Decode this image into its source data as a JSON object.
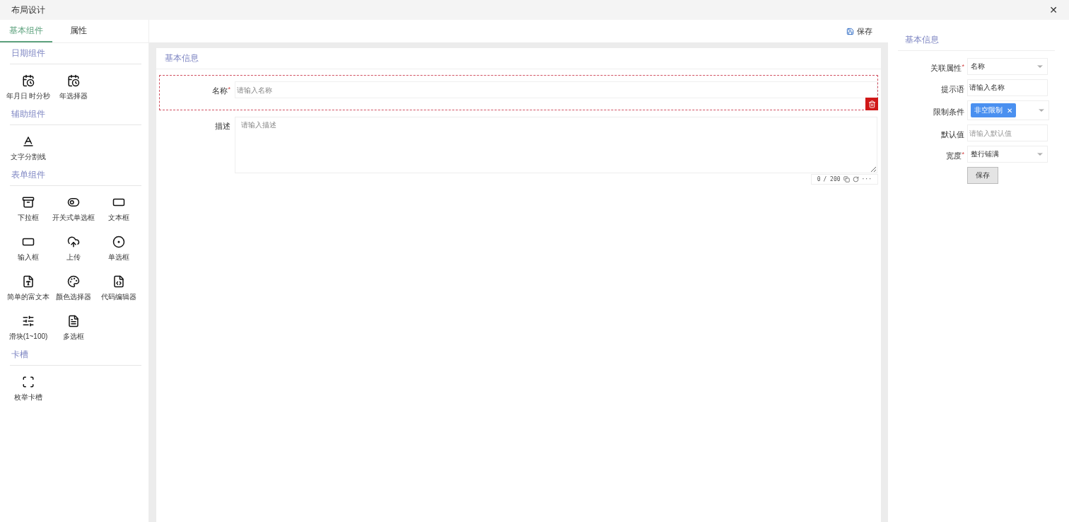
{
  "window": {
    "title": "布局设计",
    "close": "✕"
  },
  "tabs": [
    {
      "label": "基本组件",
      "selected": true
    },
    {
      "label": "属性",
      "selected": false
    }
  ],
  "palette": [
    {
      "title": "日期组件",
      "items": [
        "年月日 时分秒",
        "年选择器"
      ]
    },
    {
      "title": "辅助组件",
      "items": [
        "文字分割线"
      ]
    },
    {
      "title": "表单组件",
      "items": [
        "下拉框",
        "开关式单选框",
        "文本框",
        "输入框",
        "上传",
        "单选框",
        "简单的富文本",
        "颜色选择器",
        "代码编辑器",
        "滑块(1~100)",
        "多选框"
      ]
    },
    {
      "title": "卡槽",
      "items": [
        "枚举卡槽"
      ]
    }
  ],
  "toolbar": {
    "save": "保存"
  },
  "canvas": {
    "title": "基本信息",
    "fields": [
      {
        "kind": "input",
        "label": "名称",
        "required_mark": "*",
        "placeholder": "请输入名称",
        "selected": true
      },
      {
        "kind": "textarea",
        "label": "描述",
        "placeholder": "请输入描述",
        "selected": false,
        "count": "0",
        "max": "/ 200",
        "more": "···"
      }
    ]
  },
  "properties": {
    "title": "基本信息",
    "fields": [
      {
        "kind": "select",
        "label": "关联属性",
        "required_mark": "*",
        "value": "名称"
      },
      {
        "kind": "input",
        "label": "提示语",
        "value": "请输入名称"
      },
      {
        "kind": "tags",
        "label": "限制条件",
        "tags": [
          {
            "label": "非空限制",
            "remove": "✕"
          }
        ]
      },
      {
        "kind": "input",
        "label": "默认值",
        "placeholder": "请输入默认值"
      },
      {
        "kind": "select",
        "label": "宽度",
        "required_mark": "*",
        "value": "整行铺满"
      }
    ],
    "button": "保存"
  }
}
